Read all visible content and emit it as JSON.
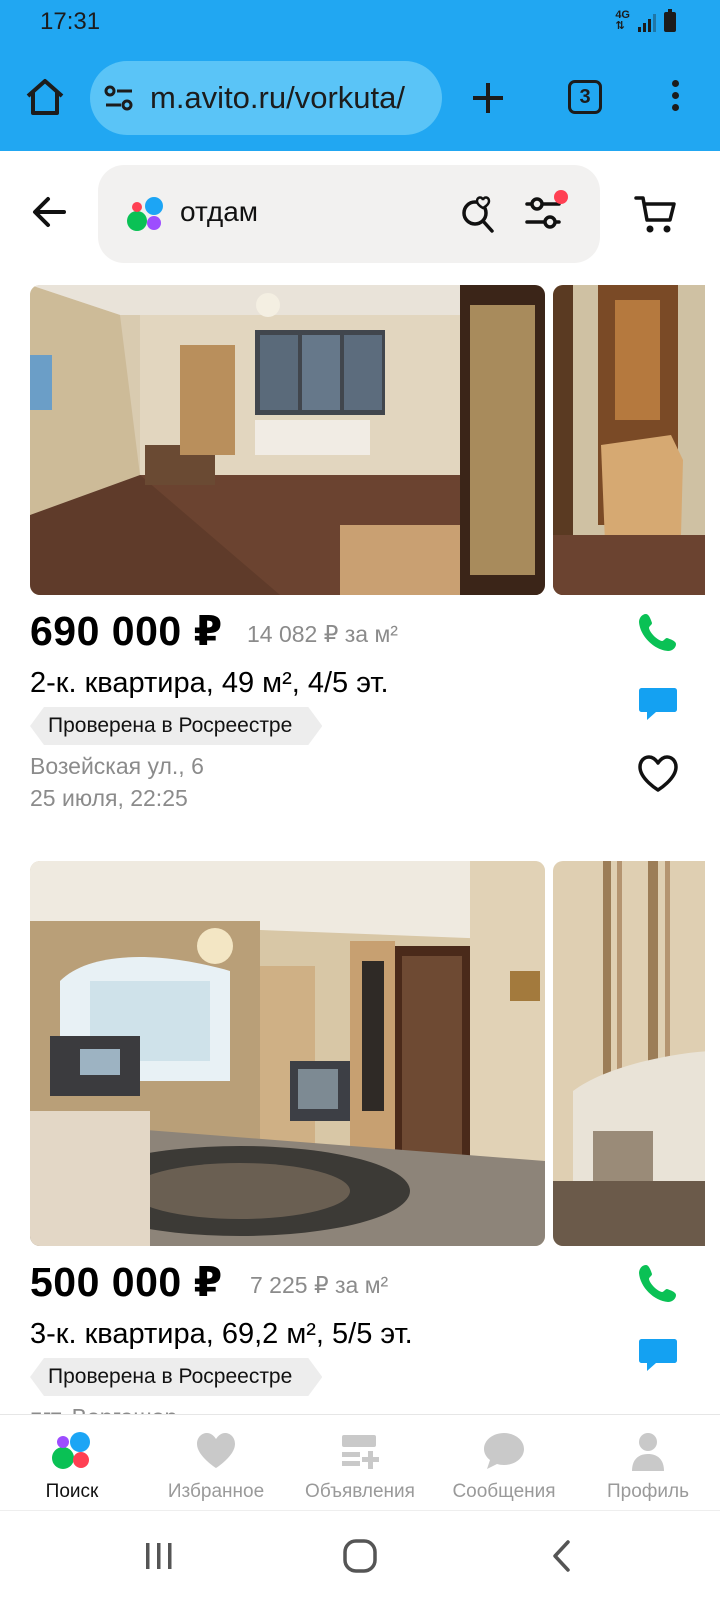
{
  "status_bar": {
    "time": "17:31",
    "network": "4G"
  },
  "browser": {
    "url": "m.avito.ru/vorkuta/",
    "tab_count": "3"
  },
  "header": {
    "search_query": "отдам"
  },
  "listings": [
    {
      "price": "690 000 ₽",
      "price_per_m2": "14 082 ₽ за м²",
      "title": "2-к. квартира, 49 м², 4/5 эт.",
      "badge": "Проверена в Росреестре",
      "address": "Возейская ул., 6",
      "date": "25 июля, 22:25"
    },
    {
      "price": "500 000 ₽",
      "price_per_m2": "7 225 ₽ за м²",
      "title": "3-к. квартира, 69,2 м², 5/5 эт.",
      "badge": "Проверена в Росреестре",
      "address": "пгт. Воргашор"
    }
  ],
  "bottom_nav": [
    {
      "label": "Поиск",
      "icon": "avito-logo-icon",
      "active": true
    },
    {
      "label": "Избранное",
      "icon": "heart-icon"
    },
    {
      "label": "Объявления",
      "icon": "add-listing-icon"
    },
    {
      "label": "Сообщения",
      "icon": "chat-bubble-icon"
    },
    {
      "label": "Профиль",
      "icon": "person-icon"
    }
  ],
  "colors": {
    "chrome_blue": "#21a7f2",
    "call_green": "#0ac155",
    "chat_blue": "#14a1f2"
  }
}
